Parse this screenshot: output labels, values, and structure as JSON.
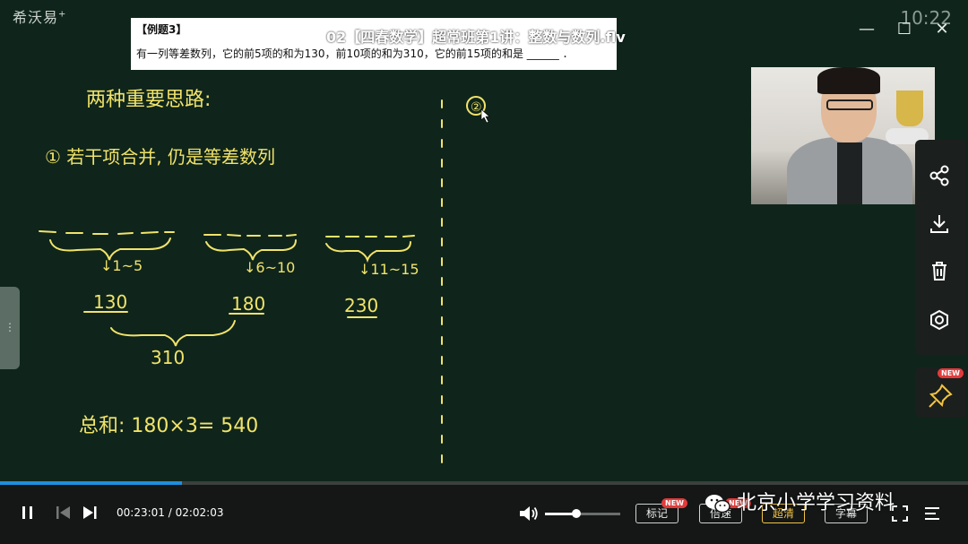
{
  "app": {
    "logo_text": "希沃易",
    "logo_plus": "+",
    "clock": "10:22"
  },
  "video": {
    "title": "02【四春数学】超常班第1讲：整数与数列.flv"
  },
  "window_controls": {
    "minimize": "—",
    "maximize": "☐",
    "close": "✕"
  },
  "problem": {
    "label": "【例题3】",
    "text": "有一列等差数列，它的前5项的和为130，前10项的和为310，它的前15项的和是 ______ ．"
  },
  "board": {
    "heading": "两种重要思路:",
    "method_1": "① 若干项合并, 仍是等差数列",
    "group_1_range": "↓1~5",
    "group_2_range": "↓6~10",
    "group_3_range": "↓11~15",
    "sum_1": "130",
    "sum_2": "180",
    "sum_3": "230",
    "combined": "310",
    "total": "总和:  180×3= 540",
    "method_2_marker": "②"
  },
  "side_tools": [
    {
      "name": "share-icon"
    },
    {
      "name": "download-icon"
    },
    {
      "name": "delete-icon"
    },
    {
      "name": "eye-icon"
    }
  ],
  "pin": {
    "badge": "NEW",
    "icon": "pin-icon"
  },
  "playback": {
    "current_time": "00:23:01",
    "total_time": "02:02:03",
    "time_separator": " / ",
    "progress": 0.188,
    "volume": 0.42
  },
  "buttons": {
    "mark": "标记",
    "mark_badge": "NEW",
    "speed": "倍速",
    "speed_badge": "NEW",
    "quality": "超清",
    "subtitle": "字幕"
  },
  "watermark": {
    "text": "北京小学学习资料"
  },
  "colors": {
    "chalk": "#f1e36a",
    "progress": "#1f8fe0",
    "active_pill": "#f3c443",
    "badge": "#e23b3b"
  }
}
